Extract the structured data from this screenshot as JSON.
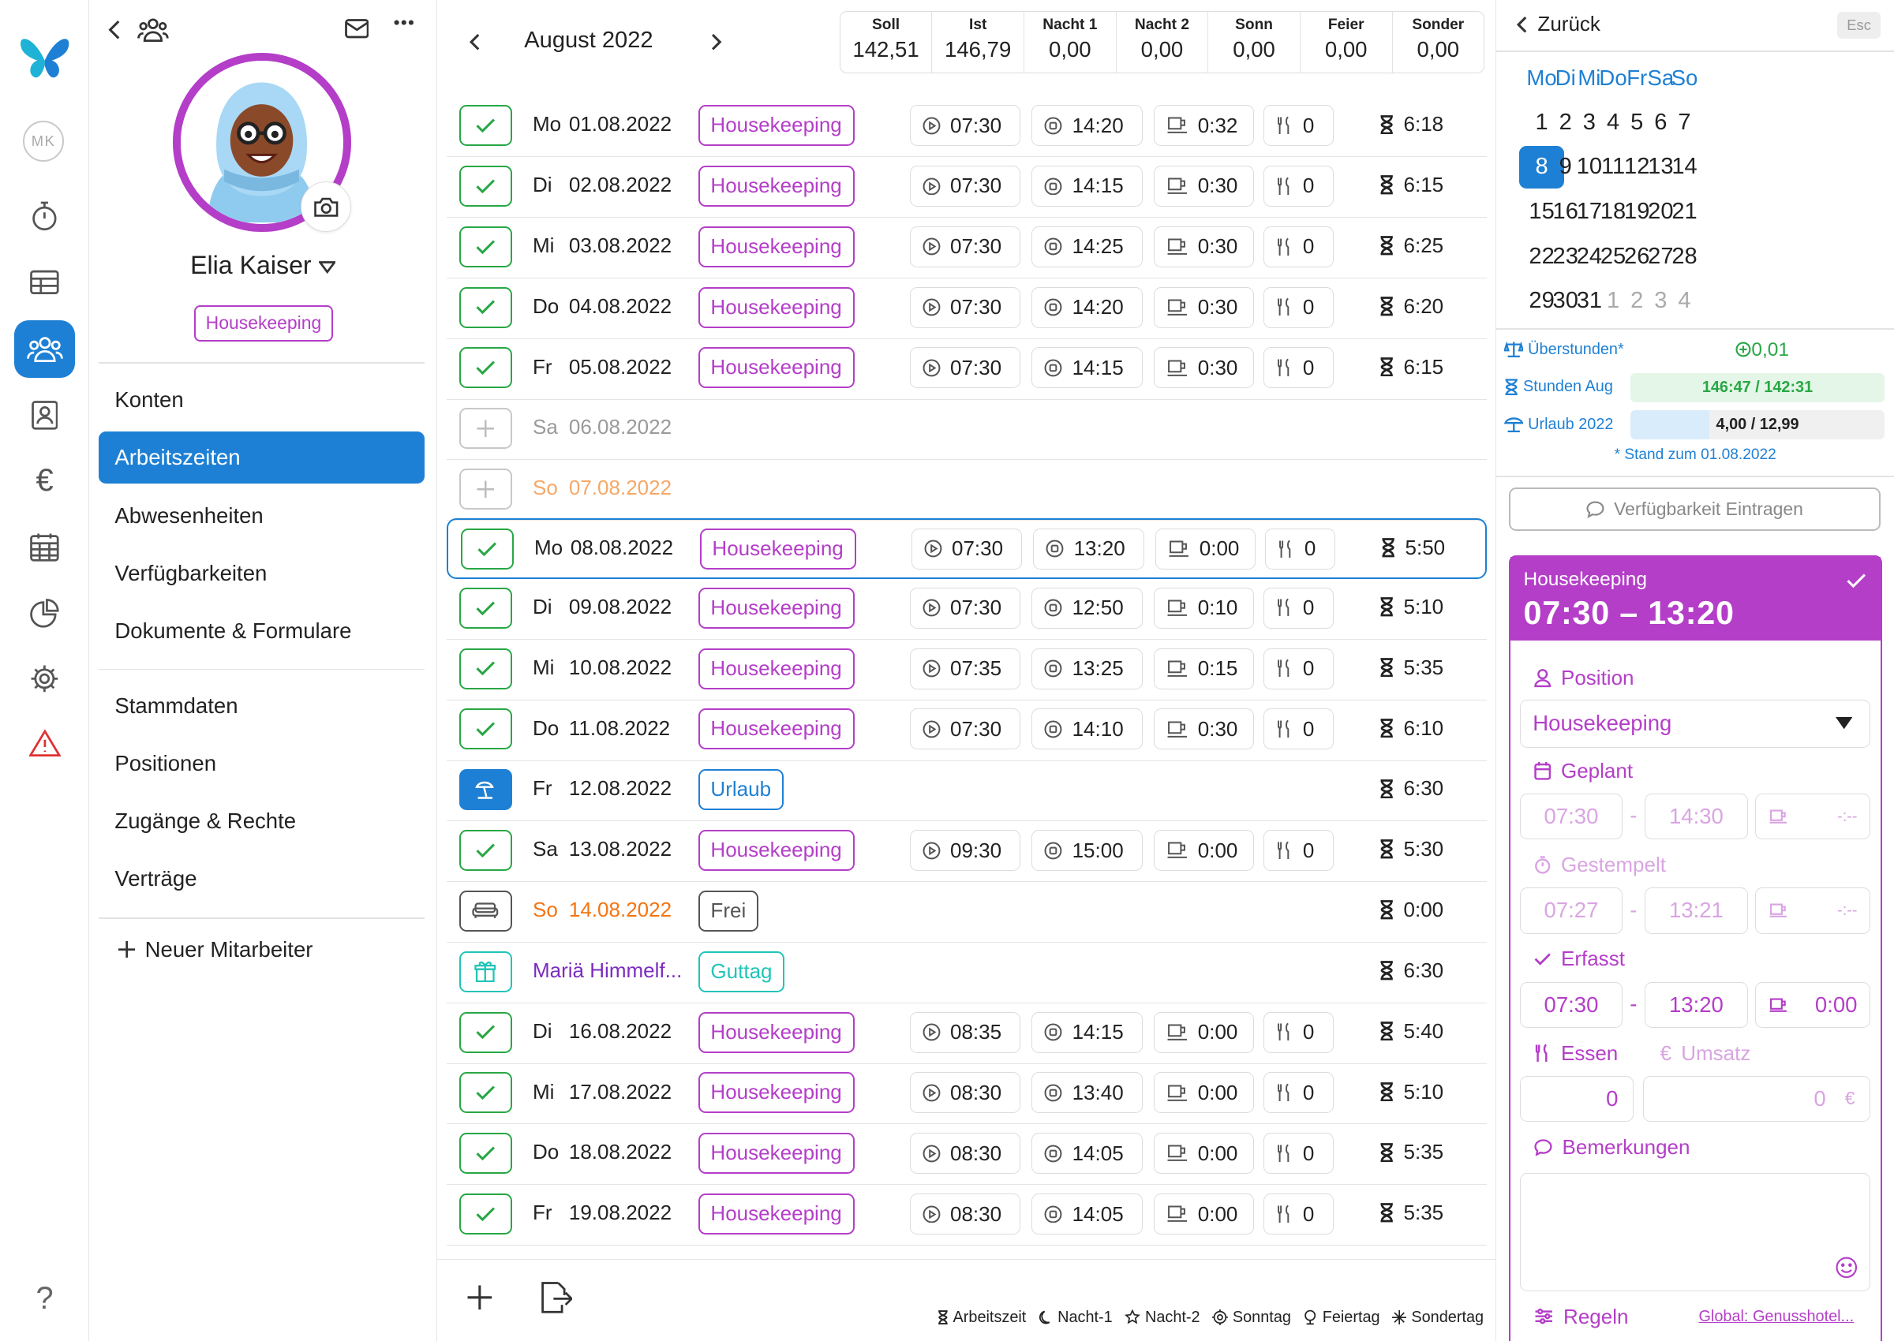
{
  "rail": {
    "initials": "MK",
    "icons": [
      "logo-icon",
      "stopwatch-icon",
      "table-icon",
      "users-icon",
      "contact-card-icon",
      "euro-icon",
      "calendar-grid-icon",
      "pie-chart-icon",
      "gear-icon",
      "warning-icon",
      "help-icon"
    ],
    "active": "users-icon",
    "help": "?"
  },
  "profile": {
    "name": "Elia Kaiser",
    "position_badge": "Housekeeping",
    "nav_primary": [
      "Konten",
      "Arbeitszeiten",
      "Abwesenheiten",
      "Verfügbarkeiten",
      "Dokumente & Formulare"
    ],
    "nav_secondary": [
      "Stammdaten",
      "Positionen",
      "Zugänge & Rechte",
      "Verträge"
    ],
    "active_nav": "Arbeitszeiten",
    "new_employee": "Neuer Mitarbeiter"
  },
  "sheet": {
    "month": "August 2022",
    "totals": [
      {
        "label": "Soll",
        "value": "142,51"
      },
      {
        "label": "Ist",
        "value": "146,79"
      },
      {
        "label": "Nacht 1",
        "value": "0,00"
      },
      {
        "label": "Nacht 2",
        "value": "0,00"
      },
      {
        "label": "Sonn",
        "value": "0,00"
      },
      {
        "label": "Feier",
        "value": "0,00"
      },
      {
        "label": "Sonder",
        "value": "0,00"
      }
    ],
    "rows": [
      {
        "kind": "work",
        "day": "Mo",
        "date": "01.08.2022",
        "badge": "Housekeeping",
        "start": "07:30",
        "end": "14:20",
        "break": "0:32",
        "meal": "0",
        "duration": "6:18"
      },
      {
        "kind": "work",
        "day": "Di",
        "date": "02.08.2022",
        "badge": "Housekeeping",
        "start": "07:30",
        "end": "14:15",
        "break": "0:30",
        "meal": "0",
        "duration": "6:15"
      },
      {
        "kind": "work",
        "day": "Mi",
        "date": "03.08.2022",
        "badge": "Housekeeping",
        "start": "07:30",
        "end": "14:25",
        "break": "0:30",
        "meal": "0",
        "duration": "6:25"
      },
      {
        "kind": "work",
        "day": "Do",
        "date": "04.08.2022",
        "badge": "Housekeeping",
        "start": "07:30",
        "end": "14:20",
        "break": "0:30",
        "meal": "0",
        "duration": "6:20"
      },
      {
        "kind": "work",
        "day": "Fr",
        "date": "05.08.2022",
        "badge": "Housekeeping",
        "start": "07:30",
        "end": "14:15",
        "break": "0:30",
        "meal": "0",
        "duration": "6:15"
      },
      {
        "kind": "empty",
        "day": "Sa",
        "date": "06.08.2022"
      },
      {
        "kind": "empty-sun",
        "day": "So",
        "date": "07.08.2022"
      },
      {
        "kind": "work",
        "selected": true,
        "day": "Mo",
        "date": "08.08.2022",
        "badge": "Housekeeping",
        "start": "07:30",
        "end": "13:20",
        "break": "0:00",
        "meal": "0",
        "duration": "5:50"
      },
      {
        "kind": "work",
        "day": "Di",
        "date": "09.08.2022",
        "badge": "Housekeeping",
        "start": "07:30",
        "end": "12:50",
        "break": "0:10",
        "meal": "0",
        "duration": "5:10"
      },
      {
        "kind": "work",
        "day": "Mi",
        "date": "10.08.2022",
        "badge": "Housekeeping",
        "start": "07:35",
        "end": "13:25",
        "break": "0:15",
        "meal": "0",
        "duration": "5:35"
      },
      {
        "kind": "work",
        "day": "Do",
        "date": "11.08.2022",
        "badge": "Housekeeping",
        "start": "07:30",
        "end": "14:10",
        "break": "0:30",
        "meal": "0",
        "duration": "6:10"
      },
      {
        "kind": "vacation",
        "day": "Fr",
        "date": "12.08.2022",
        "badge": "Urlaub",
        "duration": "6:30"
      },
      {
        "kind": "work",
        "day": "Sa",
        "date": "13.08.2022",
        "badge": "Housekeeping",
        "start": "09:30",
        "end": "15:00",
        "break": "0:00",
        "meal": "0",
        "duration": "5:30"
      },
      {
        "kind": "free",
        "day": "So",
        "date": "14.08.2022",
        "badge": "Frei",
        "duration": "0:00"
      },
      {
        "kind": "holiday",
        "name": "Mariä Himmelf...",
        "badge": "Guttag",
        "duration": "6:30"
      },
      {
        "kind": "work",
        "day": "Di",
        "date": "16.08.2022",
        "badge": "Housekeeping",
        "start": "08:35",
        "end": "14:15",
        "break": "0:00",
        "meal": "0",
        "duration": "5:40"
      },
      {
        "kind": "work",
        "day": "Mi",
        "date": "17.08.2022",
        "badge": "Housekeeping",
        "start": "08:30",
        "end": "13:40",
        "break": "0:00",
        "meal": "0",
        "duration": "5:10"
      },
      {
        "kind": "work",
        "day": "Do",
        "date": "18.08.2022",
        "badge": "Housekeeping",
        "start": "08:30",
        "end": "14:05",
        "break": "0:00",
        "meal": "0",
        "duration": "5:35"
      },
      {
        "kind": "work",
        "day": "Fr",
        "date": "19.08.2022",
        "badge": "Housekeeping",
        "start": "08:30",
        "end": "14:05",
        "break": "0:00",
        "meal": "0",
        "duration": "5:35"
      }
    ],
    "legend": [
      "Arbeitszeit",
      "Nacht-1",
      "Nacht-2",
      "Sonntag",
      "Feiertag",
      "Sondertag"
    ]
  },
  "right": {
    "back": "Zurück",
    "esc": "Esc",
    "weekdays": [
      "Mo",
      "Di",
      "Mi",
      "Do",
      "Fr",
      "Sa",
      "So"
    ],
    "weeks": [
      [
        "1",
        "2",
        "3",
        "4",
        "5",
        "6",
        "7"
      ],
      [
        "8",
        "9",
        "10",
        "11",
        "12",
        "13",
        "14"
      ],
      [
        "15",
        "16",
        "17",
        "18",
        "19",
        "20",
        "21"
      ],
      [
        "22",
        "23",
        "24",
        "25",
        "26",
        "27",
        "28"
      ],
      [
        "29",
        "30",
        "31",
        "1",
        "2",
        "3",
        "4"
      ]
    ],
    "today": "8",
    "overtime_label": "Überstunden*",
    "overtime_value": "0,01",
    "hours_label": "Stunden Aug",
    "hours_value": "146:47 / 142:31",
    "vacation_label": "Urlaub 2022",
    "vacation_value": "4,00 / 12,99",
    "vacation_fraction": 0.31,
    "stand": "* Stand zum 01.08.2022",
    "availability_button": "Verfügbarkeit Eintragen",
    "card": {
      "position_title": "Housekeeping",
      "time_range": "07:30 – 13:20",
      "position_label": "Position",
      "position_value": "Housekeeping",
      "planned_label": "Geplant",
      "planned_start": "07:30",
      "planned_end": "14:30",
      "planned_break": "-:--",
      "stamped_label": "Gestempelt",
      "stamped_start": "07:27",
      "stamped_end": "13:21",
      "stamped_break": "-:--",
      "recorded_label": "Erfasst",
      "recorded_start": "07:30",
      "recorded_end": "13:20",
      "recorded_break": "0:00",
      "meal_label": "Essen",
      "revenue_label": "Umsatz",
      "meal_value": "0",
      "revenue_value": "0",
      "revenue_unit": "€",
      "remarks_label": "Bemerkungen",
      "rules_label": "Regeln",
      "rules_link": "Global: Genusshotel...",
      "dash": "-"
    }
  },
  "colors": {
    "primary": "#1e80d4",
    "purple": "#b43ec8",
    "green": "#28a745",
    "teal": "#22c4b8",
    "orange": "#f57410"
  }
}
